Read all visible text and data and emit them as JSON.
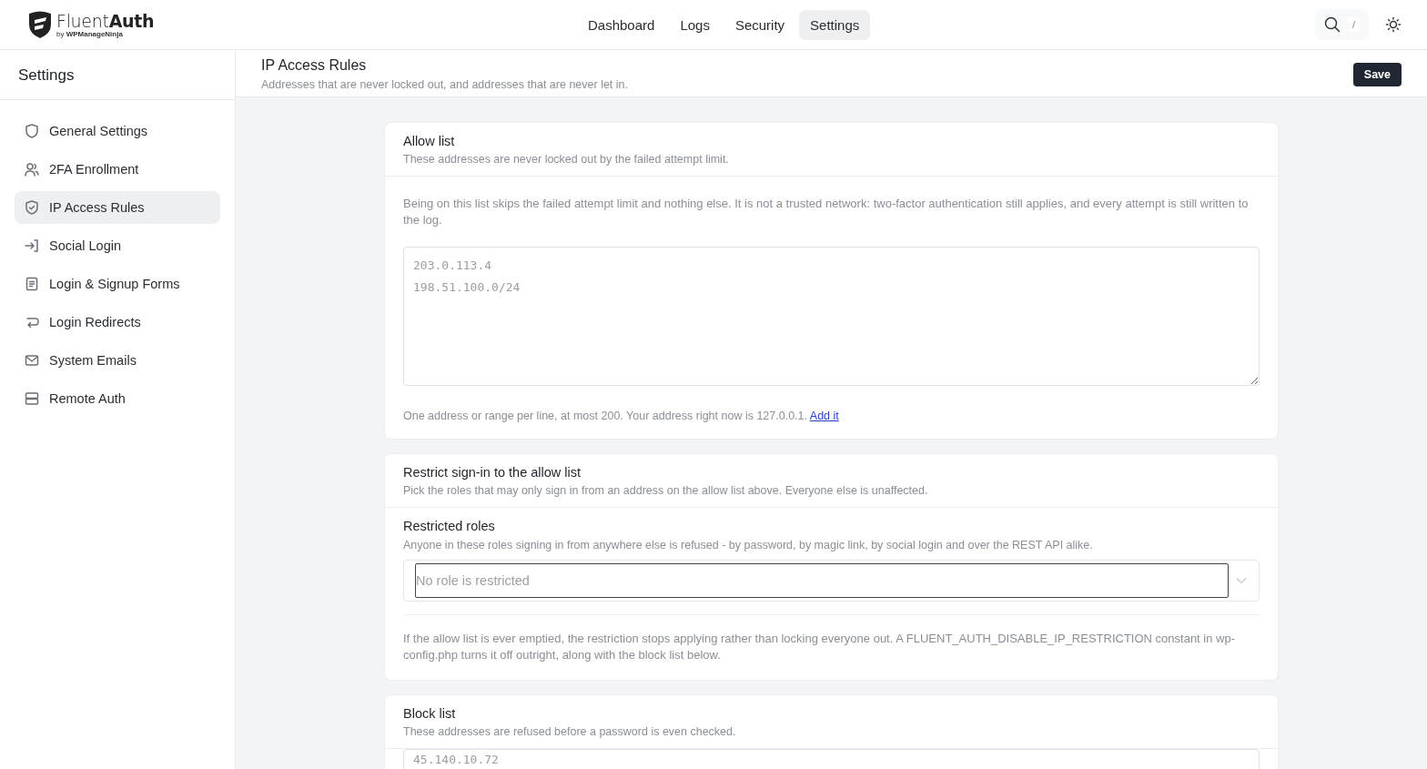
{
  "header": {
    "logo": {
      "name": "Fluent**Auth**",
      "byline": "by **WPManageNinja**"
    },
    "nav": [
      {
        "label": "Dashboard",
        "selected": false
      },
      {
        "label": "Logs",
        "selected": false
      },
      {
        "label": "Security",
        "selected": false
      },
      {
        "label": "Settings",
        "selected": true
      }
    ],
    "search_shortcut": "/"
  },
  "sidebar": {
    "title": "Settings",
    "items": [
      {
        "label": "General Settings",
        "selected": false
      },
      {
        "label": "2FA Enrollment",
        "selected": false
      },
      {
        "label": "IP Access Rules",
        "selected": true
      },
      {
        "label": "Social Login",
        "selected": false
      },
      {
        "label": "Login & Signup Forms",
        "selected": false
      },
      {
        "label": "Login Redirects",
        "selected": false
      },
      {
        "label": "System Emails",
        "selected": false
      },
      {
        "label": "Remote Auth",
        "selected": false
      }
    ]
  },
  "page": {
    "title": "IP Access Rules",
    "subtitle": "Addresses that are never locked out, and addresses that are never let in.",
    "save_button": "Save"
  },
  "sections": [
    {
      "kind": "list",
      "title": "Allow list",
      "subtitle": "These addresses are never locked out by the failed attempt limit.",
      "note": "Being on this list skips the failed attempt limit and nothing else. It is not a trusted network: two-factor authentication still applies, and every attempt is still written to the log.",
      "placeholder": "203.0.113.4\n198.51.100.0/24",
      "help": "One address or range per line, at most 200. Your address right now is 127.0.0.1.",
      "help_link": "Add it"
    },
    {
      "kind": "roles",
      "title": "Restrict sign-in to the allow list",
      "subtitle": "Pick the roles that may only sign in from an address on the allow list above. Everyone else is unaffected.",
      "field_label": "Restricted roles",
      "field_hint": "Anyone in these roles signing in from anywhere else is refused - by password, by magic link, by social login and over the REST API alike.",
      "placeholder": "No role is restricted",
      "note": "If the allow list is ever emptied, the restriction stops applying rather than locking everyone out. A FLUENT_AUTH_DISABLE_IP_RESTRICTION constant in wp-config.php turns it off outright, along with the block list below."
    },
    {
      "kind": "list",
      "title": "Block list",
      "subtitle": "These addresses are refused before a password is even checked.",
      "placeholder": "45.140.10.72"
    }
  ]
}
